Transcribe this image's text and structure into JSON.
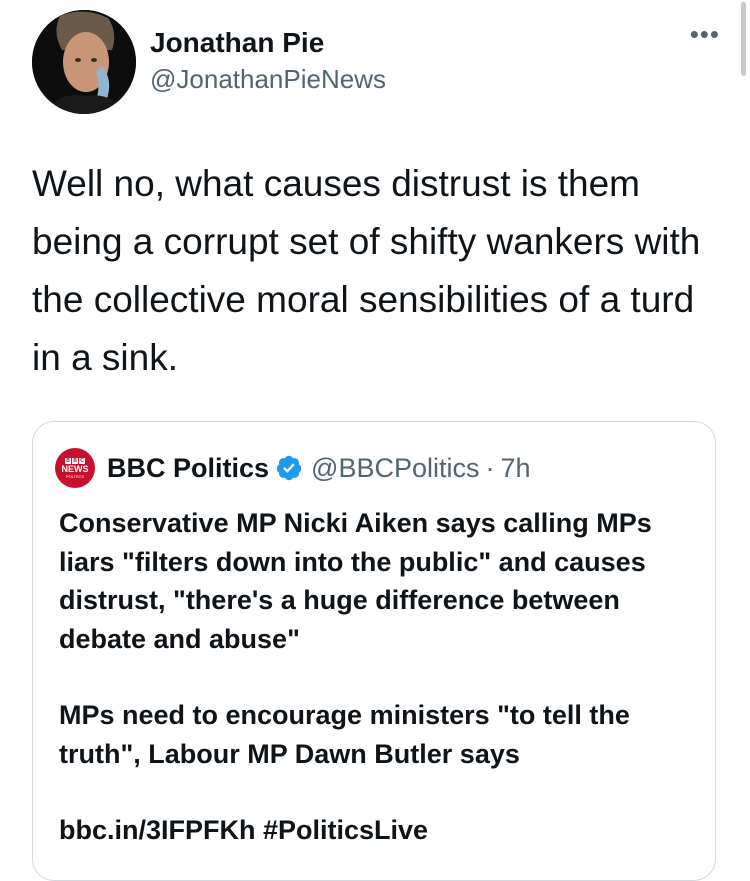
{
  "author": {
    "display_name": "Jonathan Pie",
    "handle": "@JonathanPieNews",
    "more_icon": "more-icon"
  },
  "tweet": {
    "text": "Well no, what causes distrust is them being a corrupt set of shifty wankers with the collective moral sensibilities of a turd in a sink."
  },
  "quoted_tweet": {
    "logo_text": {
      "blocks": [
        "B",
        "B",
        "C"
      ],
      "main": "NEWS",
      "sub": "POLITICS"
    },
    "display_name": "BBC Politics",
    "verified": true,
    "handle": "@BBCPolitics",
    "separator": "·",
    "time": "7h",
    "paragraph_1": "Conservative MP Nicki Aiken says calling MPs liars \"filters down into the public\" and causes distrust, \"there's a huge difference between debate and abuse\"",
    "paragraph_2": "MPs need to encourage ministers \"to tell the truth\", Labour MP Dawn Butler says",
    "link_line": "bbc.in/3IFPFKh #PoliticsLive"
  },
  "colors": {
    "text": "#0f1419",
    "secondary": "#536471",
    "border": "#cfd9de",
    "verified": "#1d9bf0",
    "bbc_red": "#c8102e"
  }
}
